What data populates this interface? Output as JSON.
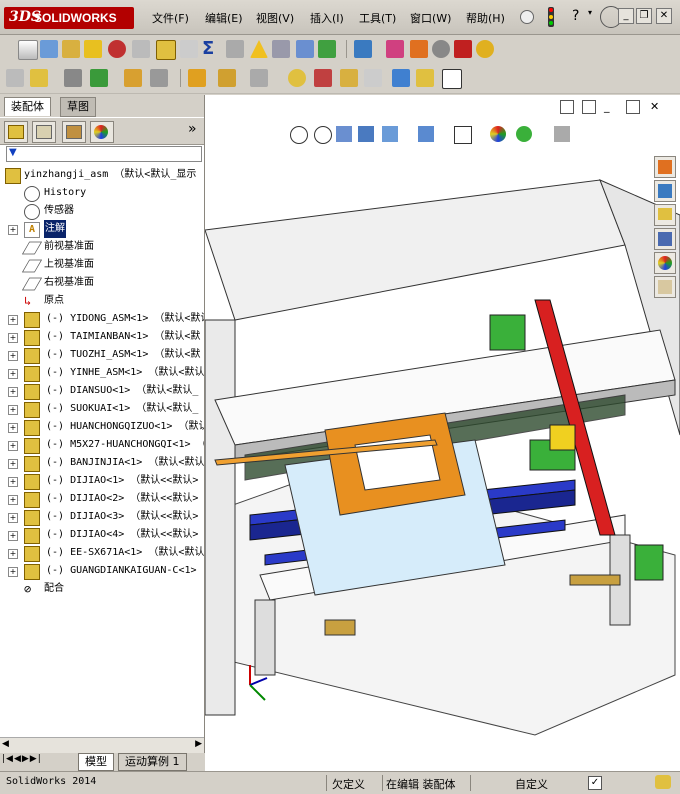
{
  "app": {
    "logo_mark": "3DS",
    "logo_text": "SOLIDWORKS"
  },
  "menu": [
    "文件(F)",
    "编辑(E)",
    "视图(V)",
    "插入(I)",
    "工具(T)",
    "窗口(W)",
    "帮助(H)"
  ],
  "panel_tabs": [
    "装配体",
    "草图"
  ],
  "expand_symbol": "»",
  "tree": {
    "root": "yinzhangji_asm （默认<默认_显示",
    "fixed_items": [
      "History",
      "传感器",
      "注解",
      "前视基准面",
      "上视基准面",
      "右视基准面",
      "原点"
    ],
    "components": [
      "(-) YIDONG_ASM<1> （默认<默认",
      "(-) TAIMIANBAN<1> （默认<默",
      "(-) TUOZHI_ASM<1> （默认<默",
      "(-) YINHE_ASM<1> （默认<默认",
      "(-) DIANSUO<1> （默认<默认_",
      "(-) SUOKUAI<1> （默认<默认_",
      "(-) HUANCHONGQIZUO<1> （默认",
      "(-) M5X27-HUANCHONGQI<1> （",
      "(-) BANJINJIA<1> （默认<默认_",
      "(-) DIJIAO<1> （默认<<默认>",
      "(-) DIJIAO<2> （默认<<默认>",
      "(-) DIJIAO<3> （默认<<默认>",
      "(-) DIJIAO<4> （默认<<默认>",
      "(-) EE-SX671A<1> （默认<默认",
      "(-) GUANGDIANKAIGUAN-C<1>"
    ],
    "mates": "配合"
  },
  "bottom_tabs": [
    "模型",
    "运动算例 1"
  ],
  "status": {
    "app": "SolidWorks 2014",
    "defined": "欠定义",
    "mode": "在编辑 装配体",
    "custom": "自定义"
  },
  "colors": {
    "brand": "#b30000",
    "selection": "#0a246a"
  },
  "icons": {
    "help": "?",
    "minimize": "_",
    "restore": "❐",
    "close": "✕"
  }
}
